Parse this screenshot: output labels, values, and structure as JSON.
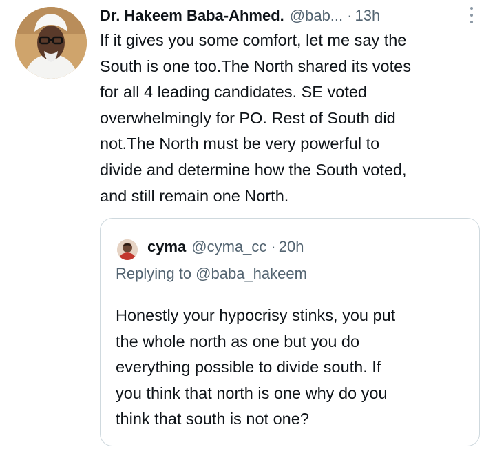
{
  "tweet": {
    "author_name": "Dr. Hakeem Baba-Ahmed.",
    "handle": "@bab...",
    "separator": "·",
    "time": "13h",
    "lines": [
      "If it gives you some comfort, let me say the",
      "South is one too.The North shared its votes",
      "for all 4 leading  candidates. SE voted",
      "overwhelmingly for PO. Rest of South did",
      "not.The North must be very powerful to",
      "divide and determine how the South voted,",
      "and still remain one North."
    ]
  },
  "quoted_tweet": {
    "author_name": "cyma",
    "handle": "@cyma_cc",
    "separator": "·",
    "time": "20h",
    "replying_to": "Replying to @baba_hakeem",
    "lines": [
      "Honestly your hypocrisy stinks,  you put",
      "the whole north as one but you  do",
      "everything possible to divide south. If",
      "you think that north is one why do you",
      "think that south is not one?"
    ]
  },
  "icons": {
    "author_avatar": "avatar",
    "more": "more-icon",
    "quoted_avatar": "avatar"
  }
}
